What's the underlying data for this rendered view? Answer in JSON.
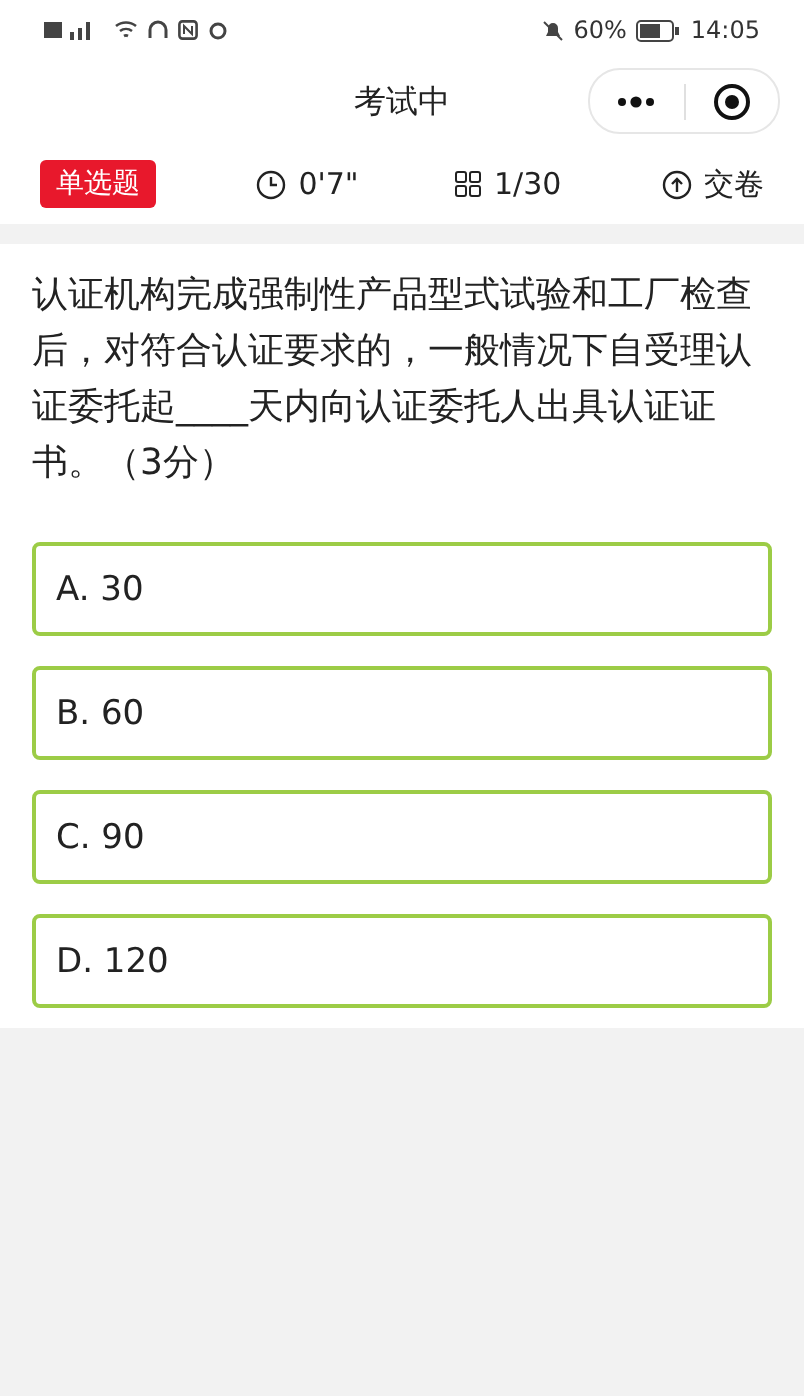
{
  "status_bar": {
    "battery_percent": "60%",
    "time": "14:05"
  },
  "nav": {
    "title": "考试中"
  },
  "toolbar": {
    "type_badge": "单选题",
    "timer": "0'7\"",
    "progress": "1/30",
    "submit": "交卷"
  },
  "question": {
    "text": "认证机构完成强制性产品型式试验和工厂检查后，对符合认证要求的，一般情况下自受理认证委托起____天内向认证委托人出具认证证书。（3分）"
  },
  "options": [
    {
      "label": "A. 30",
      "selected": false
    },
    {
      "label": "B. 60",
      "selected": false
    },
    {
      "label": "C. 90",
      "selected": false
    },
    {
      "label": "D. 120",
      "selected": false
    }
  ]
}
